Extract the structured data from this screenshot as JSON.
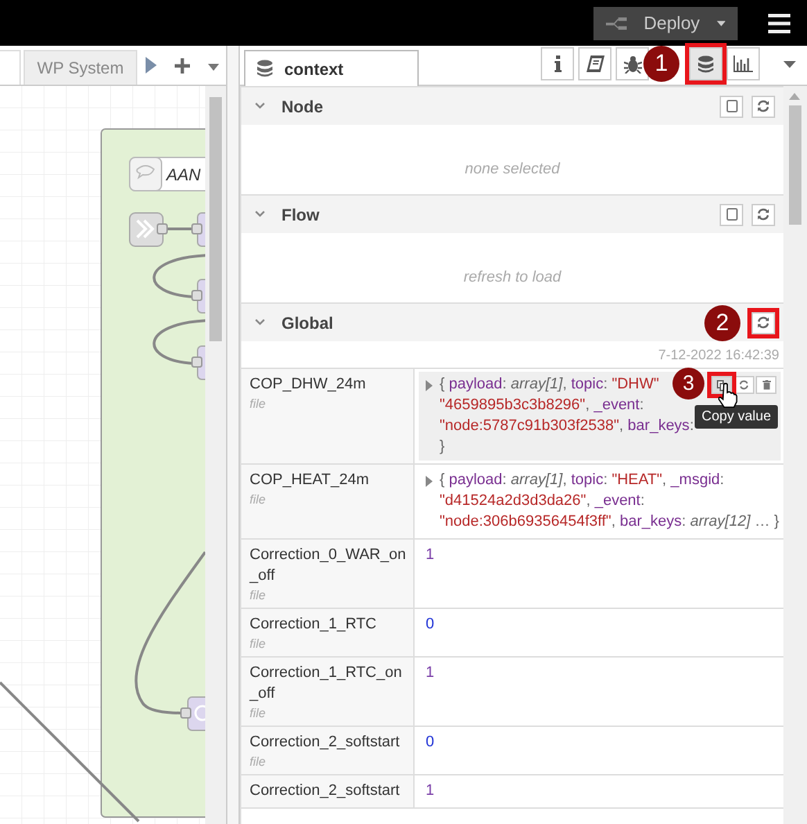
{
  "header": {
    "deploy_label": "Deploy"
  },
  "workspace": {
    "tabs": [
      {
        "label": "WP System",
        "selected": false
      }
    ],
    "canvas": {
      "comment": "AAN"
    }
  },
  "sidebar": {
    "tabs": [
      {
        "label": "context",
        "selected": true
      }
    ],
    "tool_buttons": [
      {
        "kind": "info",
        "selected": false
      },
      {
        "kind": "book",
        "selected": false
      },
      {
        "kind": "bug",
        "selected": false
      },
      {
        "kind": "database",
        "selected": true,
        "annotation": "1"
      },
      {
        "kind": "chart",
        "selected": false
      }
    ],
    "sections": [
      {
        "title": "Node",
        "expanded": true,
        "buttons": [
          {
            "kind": "collapse"
          },
          {
            "kind": "refresh"
          }
        ],
        "message": "none selected"
      },
      {
        "title": "Flow",
        "expanded": true,
        "buttons": [
          {
            "kind": "collapse"
          },
          {
            "kind": "refresh"
          }
        ],
        "message": "refresh to load"
      },
      {
        "title": "Global",
        "expanded": true,
        "buttons": [
          {
            "kind": "refresh",
            "annotation": "2"
          }
        ],
        "timestamp": "7-12-2022 16:42:39",
        "rows": [
          {
            "key": "COP_DHW_24m",
            "source": "file",
            "expandable": true,
            "hovered": true,
            "copy_annotation": "3",
            "tooltip": "Copy value",
            "lines": [
              [
                {
                  "kind": "punct",
                  "text": "{ "
                },
                {
                  "kind": "key",
                  "text": "payload"
                },
                {
                  "kind": "punct",
                  "text": ": "
                },
                {
                  "kind": "type",
                  "text": "array[1]"
                },
                {
                  "kind": "punct",
                  "text": ", "
                },
                {
                  "kind": "key",
                  "text": "topic"
                },
                {
                  "kind": "punct",
                  "text": ": "
                },
                {
                  "kind": "string",
                  "text": "\"DHW\""
                }
              ],
              [
                {
                  "kind": "string",
                  "text": "\"4659895b3c3b8296\""
                },
                {
                  "kind": "punct",
                  "text": ", "
                },
                {
                  "kind": "key",
                  "text": "_event"
                },
                {
                  "kind": "punct",
                  "text": ":"
                }
              ],
              [
                {
                  "kind": "string",
                  "text": "\"node:5787c91b303f2538\""
                },
                {
                  "kind": "punct",
                  "text": ", "
                },
                {
                  "kind": "key",
                  "text": "bar_keys"
                },
                {
                  "kind": "punct",
                  "text": ":"
                }
              ],
              [
                {
                  "kind": "punct",
                  "text": "}"
                }
              ]
            ]
          },
          {
            "key": "COP_HEAT_24m",
            "source": "file",
            "expandable": true,
            "hovered": false,
            "lines": [
              [
                {
                  "kind": "punct",
                  "text": "{ "
                },
                {
                  "kind": "key",
                  "text": "payload"
                },
                {
                  "kind": "punct",
                  "text": ": "
                },
                {
                  "kind": "type",
                  "text": "array[1]"
                },
                {
                  "kind": "punct",
                  "text": ", "
                },
                {
                  "kind": "key",
                  "text": "topic"
                },
                {
                  "kind": "punct",
                  "text": ": "
                },
                {
                  "kind": "string",
                  "text": "\"HEAT\""
                },
                {
                  "kind": "punct",
                  "text": ", "
                },
                {
                  "kind": "key",
                  "text": "_msgid"
                },
                {
                  "kind": "punct",
                  "text": ":"
                }
              ],
              [
                {
                  "kind": "string",
                  "text": "\"d41524a2d3d3da26\""
                },
                {
                  "kind": "punct",
                  "text": ", "
                },
                {
                  "kind": "key",
                  "text": "_event"
                },
                {
                  "kind": "punct",
                  "text": ":"
                }
              ],
              [
                {
                  "kind": "string",
                  "text": "\"node:306b69356454f3ff\""
                },
                {
                  "kind": "punct",
                  "text": ", "
                },
                {
                  "kind": "key",
                  "text": "bar_keys"
                },
                {
                  "kind": "punct",
                  "text": ": "
                },
                {
                  "kind": "type",
                  "text": "array[12]"
                },
                {
                  "kind": "punct",
                  "text": " … }"
                }
              ]
            ]
          },
          {
            "key": "Correction_0_WAR_on_off",
            "source": "file",
            "expandable": false,
            "hovered": false,
            "lines": [
              [
                {
                  "kind": "bool",
                  "text": "1"
                }
              ]
            ]
          },
          {
            "key": "Correction_1_RTC",
            "source": "file",
            "expandable": false,
            "hovered": false,
            "lines": [
              [
                {
                  "kind": "number",
                  "text": "0"
                }
              ]
            ]
          },
          {
            "key": "Correction_1_RTC_on_off",
            "source": "file",
            "expandable": false,
            "hovered": false,
            "lines": [
              [
                {
                  "kind": "bool",
                  "text": "1"
                }
              ]
            ]
          },
          {
            "key": "Correction_2_softstart",
            "source": "file",
            "expandable": false,
            "hovered": false,
            "lines": [
              [
                {
                  "kind": "number",
                  "text": "0"
                }
              ]
            ]
          },
          {
            "key": "Correction_2_softstart",
            "expandable": false,
            "hovered": false,
            "lines": [
              [
                {
                  "kind": "bool",
                  "text": "1"
                }
              ]
            ]
          }
        ]
      }
    ]
  }
}
